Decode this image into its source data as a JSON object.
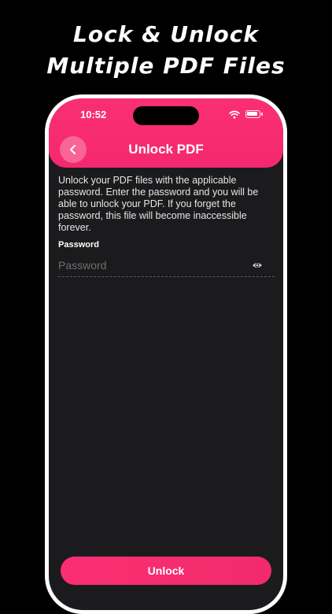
{
  "promo": {
    "line1": "Lock & Unlock",
    "line2": "Multiple PDF Files"
  },
  "status_bar": {
    "time": "10:52"
  },
  "header": {
    "title": "Unlock PDF",
    "back_icon": "chevron-left-icon"
  },
  "description": "Unlock your PDF files with the applicable password. Enter the password and you will be able to unlock your PDF. If you forget the password, this file will become inaccessible forever.",
  "password_field": {
    "label": "Password",
    "placeholder": "Password",
    "value": "",
    "toggle_icon": "eye-icon"
  },
  "unlock_button": {
    "label": "Unlock"
  },
  "colors": {
    "accent": "#f82c70",
    "background": "#000000",
    "screen": "#1b1b1d"
  }
}
